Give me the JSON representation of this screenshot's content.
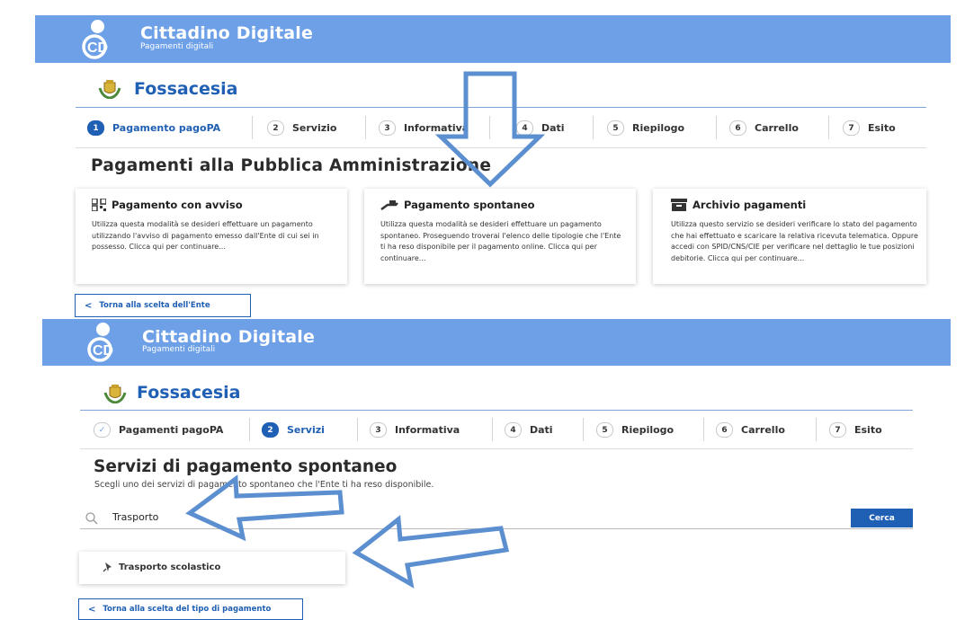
{
  "app": {
    "title": "Cittadino Digitale",
    "subtitle": "Pagamenti digitali"
  },
  "municipality": {
    "name": "Fossacesia"
  },
  "screen1": {
    "steps": [
      {
        "num": "1",
        "label": "Pagamento pagoPA",
        "state": "active"
      },
      {
        "num": "2",
        "label": "Servizio"
      },
      {
        "num": "3",
        "label": "Informativa"
      },
      {
        "num": "4",
        "label": "Dati"
      },
      {
        "num": "5",
        "label": "Riepilogo"
      },
      {
        "num": "6",
        "label": "Carrello"
      },
      {
        "num": "7",
        "label": "Esito"
      }
    ],
    "heading": "Pagamenti alla Pubblica Amministrazione",
    "cards": [
      {
        "icon": "qr-code-icon",
        "title": "Pagamento con avviso",
        "text": "Utilizza questa modalità se desideri effettuare un pagamento utilizzando l'avviso di pagamento emesso dall'Ente di cui sei in possesso. Clicca qui per continuare..."
      },
      {
        "icon": "hand-payment-icon",
        "title": "Pagamento spontaneo",
        "text": "Utilizza questa modalità se desideri effettuare un pagamento spontaneo. Proseguendo troverai l'elenco delle tipologie che l'Ente ti ha reso disponibile per il pagamento online. Clicca qui per continuare..."
      },
      {
        "icon": "archive-icon",
        "title": "Archivio pagamenti",
        "text": "Utilizza questo servizio se desideri verificare lo stato del pagamento che hai effettuato e scaricare la relativa ricevuta telematica. Oppure accedi con SPID/CNS/CIE per verificare nel dettaglio le tue posizioni debitorie. Clicca qui per continuare..."
      }
    ],
    "back_button": "Torna alla scelta dell'Ente"
  },
  "screen2": {
    "steps": [
      {
        "num": "✓",
        "label": "Pagamenti pagoPA",
        "state": "done"
      },
      {
        "num": "2",
        "label": "Servizi",
        "state": "active"
      },
      {
        "num": "3",
        "label": "Informativa"
      },
      {
        "num": "4",
        "label": "Dati"
      },
      {
        "num": "5",
        "label": "Riepilogo"
      },
      {
        "num": "6",
        "label": "Carrello"
      },
      {
        "num": "7",
        "label": "Esito"
      }
    ],
    "heading": "Servizi di pagamento spontaneo",
    "subheading": "Scegli uno dei servizi di pagamento spontaneo che l'Ente ti ha reso disponibile.",
    "search": {
      "value": "Trasporto",
      "button": "Cerca"
    },
    "result": {
      "icon": "pin-icon",
      "label": "Trasporto scolastico"
    },
    "back_button": "Torna alla scelta del tipo di pagamento"
  },
  "colors": {
    "header": "#6ea0e8",
    "brand": "#1f5fb4",
    "arrow": "#5b8fd0"
  }
}
